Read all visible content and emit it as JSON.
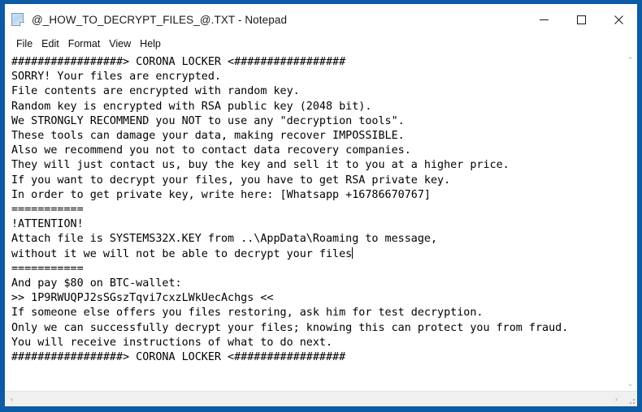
{
  "window": {
    "title": "@_HOW_TO_DECRYPT_FILES_@.TXT - Notepad",
    "icon": "notepad-document-icon",
    "border_color": "#0c5ba4",
    "controls": {
      "minimize": "minimize-button",
      "maximize": "maximize-button",
      "close": "close-button"
    }
  },
  "menubar": {
    "items": [
      {
        "label": "File"
      },
      {
        "label": "Edit"
      },
      {
        "label": "Format"
      },
      {
        "label": "View"
      },
      {
        "label": "Help"
      }
    ]
  },
  "document": {
    "lines": [
      "#################> CORONA LOCKER <#################",
      "SORRY! Your files are encrypted.",
      "File contents are encrypted with random key.",
      "Random key is encrypted with RSA public key (2048 bit).",
      "We STRONGLY RECOMMEND you NOT to use any \"decryption tools\".",
      "These tools can damage your data, making recover IMPOSSIBLE.",
      "Also we recommend you not to contact data recovery companies.",
      "They will just contact us, buy the key and sell it to you at a higher price.",
      "If you want to decrypt your files, you have to get RSA private key.",
      "In order to get private key, write here: [Whatsapp +16786670767]",
      "===========",
      "!ATTENTION!",
      "Attach file is SYSTEMS32X.KEY from ..\\AppData\\Roaming to message,",
      "without it we will not be able to decrypt your files",
      "===========",
      "And pay $80 on BTC-wallet:",
      ">> 1P9RWUQPJ2sSGszTqvi7cxzLWkUecAchgs <<",
      "If someone else offers you files restoring, ask him for test decryption.",
      "Only we can successfully decrypt your files; knowing this can protect you from fraud.",
      "You will receive instructions of what to do next.",
      "#################> CORONA LOCKER <#################"
    ],
    "caret_line_index": 13,
    "contact_whatsapp": "+16786670767",
    "btc_wallet": "1P9RWUQPJ2sSGszTqvi7cxzLWkUecAchgs",
    "ransom_amount": "$80",
    "key_file": "SYSTEMS32X.KEY",
    "key_file_path": "..\\AppData\\Roaming",
    "encryption": "RSA public key (2048 bit)",
    "locker_name": "CORONA LOCKER"
  },
  "scrollbars": {
    "vertical": {
      "up_arrow": "⌃",
      "down_arrow": "⌄"
    },
    "horizontal": {
      "left_arrow": "‹",
      "right_arrow": "›"
    }
  }
}
